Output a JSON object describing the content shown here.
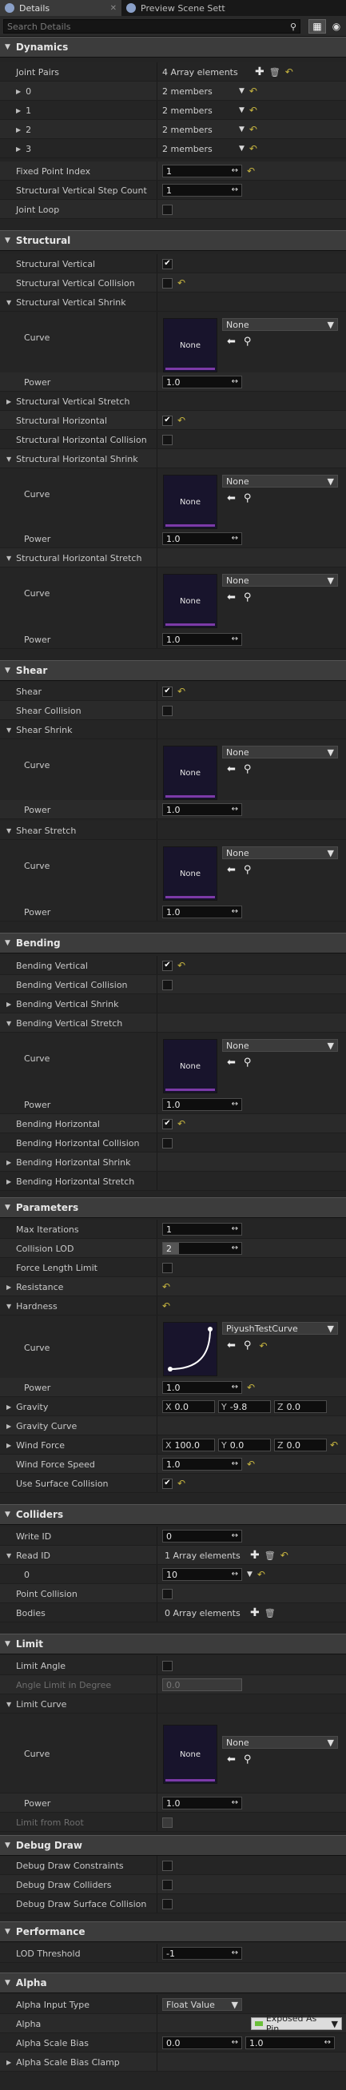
{
  "tabs": [
    {
      "label": "Details"
    },
    {
      "label": "Preview Scene Sett"
    }
  ],
  "search": {
    "placeholder": "Search Details"
  },
  "categories": {
    "dynamics": "Dynamics",
    "structural": "Structural",
    "shear": "Shear",
    "bending": "Bending",
    "parameters": "Parameters",
    "colliders": "Colliders",
    "limit": "Limit",
    "debug": "Debug Draw",
    "performance": "Performance",
    "alpha": "Alpha"
  },
  "dynamics": {
    "joint_pairs": {
      "label": "Joint Pairs",
      "value": "4 Array elements"
    },
    "pairs": [
      {
        "label": "0",
        "value": "2 members"
      },
      {
        "label": "1",
        "value": "2 members"
      },
      {
        "label": "2",
        "value": "2 members"
      },
      {
        "label": "3",
        "value": "2 members"
      }
    ],
    "fixed_point_index": {
      "label": "Fixed Point Index",
      "value": "1"
    },
    "step_count": {
      "label": "Structural Vertical Step Count",
      "value": "1"
    },
    "joint_loop": {
      "label": "Joint Loop"
    }
  },
  "curve": {
    "none_label": "None",
    "dropdown_none": "None",
    "curve_label": "Curve",
    "power_label": "Power",
    "power_value": "1.0",
    "custom_curve": "PiyushTestCurve"
  },
  "structural": {
    "vertical": "Structural Vertical",
    "vertical_collision": "Structural Vertical Collision",
    "vertical_shrink": "Structural Vertical Shrink",
    "vertical_stretch": "Structural Vertical Stretch",
    "horizontal": "Structural Horizontal",
    "horizontal_collision": "Structural Horizontal Collision",
    "horizontal_shrink": "Structural Horizontal Shrink",
    "horizontal_stretch": "Structural Horizontal Stretch"
  },
  "shear": {
    "shear": "Shear",
    "collision": "Shear Collision",
    "shrink": "Shear Shrink",
    "stretch": "Shear Stretch"
  },
  "bending": {
    "vertical": "Bending Vertical",
    "vertical_collision": "Bending Vertical Collision",
    "vertical_shrink": "Bending Vertical Shrink",
    "vertical_stretch": "Bending Vertical Stretch",
    "horizontal": "Bending Horizontal",
    "horizontal_collision": "Bending Horizontal Collision",
    "horizontal_shrink": "Bending Horizontal Shrink",
    "horizontal_stretch": "Bending Horizontal Stretch"
  },
  "parameters": {
    "max_iterations": {
      "label": "Max Iterations",
      "value": "1"
    },
    "collision_lod": {
      "label": "Collision LOD",
      "value": "2",
      "fill": 0.2
    },
    "force_length_limit": {
      "label": "Force Length Limit"
    },
    "resistance": {
      "label": "Resistance"
    },
    "hardness": {
      "label": "Hardness"
    },
    "gravity": {
      "label": "Gravity",
      "x": "0.0",
      "y": "-9.8",
      "z": "0.0"
    },
    "gravity_curve": {
      "label": "Gravity Curve"
    },
    "wind_force": {
      "label": "Wind Force",
      "x": "100.0",
      "y": "0.0",
      "z": "0.0"
    },
    "wind_force_speed": {
      "label": "Wind Force Speed",
      "value": "1.0"
    },
    "use_surface_collision": {
      "label": "Use Surface Collision"
    }
  },
  "colliders": {
    "write_id": {
      "label": "Write ID",
      "value": "0"
    },
    "read_id": {
      "label": "Read ID",
      "value": "1 Array elements"
    },
    "read_id_0": {
      "label": "0",
      "value": "10"
    },
    "point_collision": {
      "label": "Point Collision"
    },
    "bodies": {
      "label": "Bodies",
      "value": "0 Array elements"
    }
  },
  "limit": {
    "limit_angle": {
      "label": "Limit Angle"
    },
    "angle_limit_degree": {
      "label": "Angle Limit in Degree",
      "value": "0.0"
    },
    "limit_curve": {
      "label": "Limit Curve"
    },
    "limit_from_root": {
      "label": "Limit from Root"
    }
  },
  "debug": {
    "constraints": "Debug Draw Constraints",
    "colliders": "Debug Draw Colliders",
    "surface_collision": "Debug Draw Surface Collision"
  },
  "performance": {
    "lod_threshold": {
      "label": "LOD Threshold",
      "value": "-1"
    }
  },
  "alpha": {
    "input_type": {
      "label": "Alpha Input Type",
      "value": "Float Value"
    },
    "alpha": {
      "label": "Alpha",
      "value": "Exposed As Pin"
    },
    "scale_bias": {
      "label": "Alpha Scale Bias",
      "min": "0.0",
      "max": "1.0"
    },
    "scale_bias_clamp": {
      "label": "Alpha Scale Bias Clamp"
    }
  },
  "icons": {
    "reset": "reset-arrow-icon",
    "add": "add-icon",
    "delete": "trash-icon",
    "search": "search-icon",
    "view": "view-options-icon",
    "eye": "eye-icon"
  },
  "colors": {
    "reset": "#c8b640",
    "curve_bar": "#7c3aa8",
    "curve_bg": "#18142c"
  }
}
